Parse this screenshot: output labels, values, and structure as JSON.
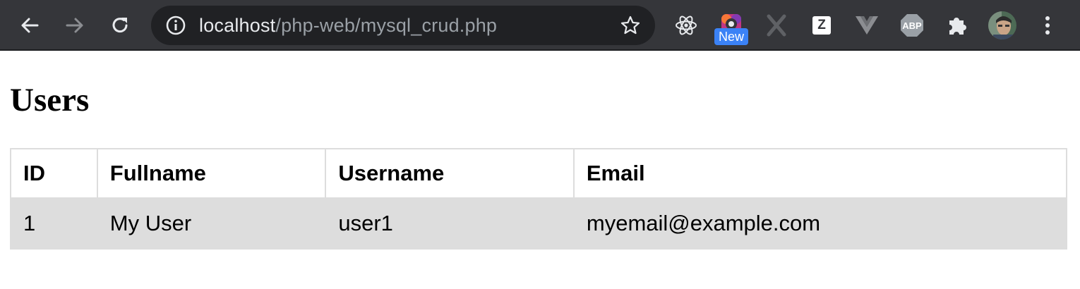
{
  "browser": {
    "url_host": "localhost",
    "url_path": "/php-web/mysql_crud.php",
    "extensions": [
      {
        "name": "react-devtools-icon"
      },
      {
        "name": "color-picker-icon",
        "badge": "New"
      },
      {
        "name": "x-extension-icon"
      },
      {
        "name": "z-extension-icon"
      },
      {
        "name": "vue-devtools-icon"
      },
      {
        "name": "adblock-plus-icon",
        "label": "ABP"
      },
      {
        "name": "extensions-puzzle-icon"
      },
      {
        "name": "profile-avatar"
      },
      {
        "name": "menu-kebab-icon"
      }
    ],
    "badge_new": "New",
    "abp_label": "ABP",
    "z_label": "Z"
  },
  "page": {
    "title": "Users",
    "table": {
      "headers": [
        "ID",
        "Fullname",
        "Username",
        "Email"
      ],
      "rows": [
        [
          "1",
          "My User",
          "user1",
          "myemail@example.com"
        ]
      ]
    }
  },
  "colors": {
    "toolbar_bg": "#35363a",
    "omnibox_bg": "#202124",
    "row_bg": "#dddddd",
    "badge_blue": "#3b82f6"
  }
}
